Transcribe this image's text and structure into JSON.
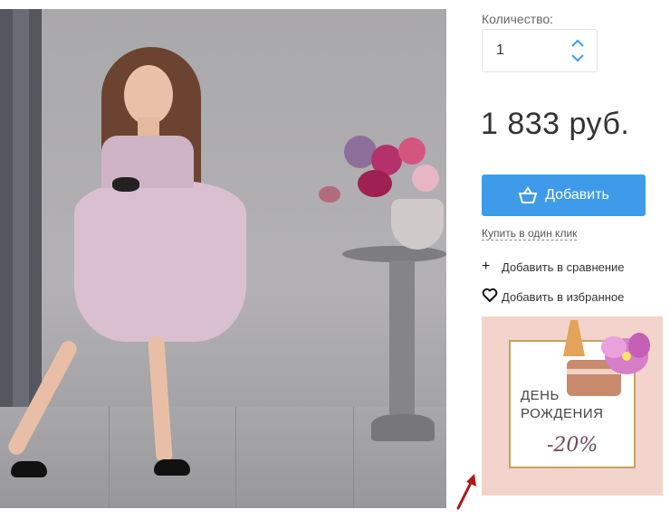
{
  "quantity": {
    "label": "Количество:",
    "value": "1"
  },
  "price": "1 833 руб.",
  "cart": {
    "add_label": "Добавить"
  },
  "links": {
    "one_click": "Купить в один клик",
    "compare": "Добавить в сравнение",
    "favorites": "Добавить в избранное"
  },
  "banner": {
    "title_line1": "ДЕНЬ",
    "title_line2": "РОЖДЕНИЯ",
    "discount": "-20%"
  },
  "colors": {
    "accent": "#3d9be9",
    "banner_bg": "#f2d4cc",
    "gold": "#c7a35e"
  }
}
